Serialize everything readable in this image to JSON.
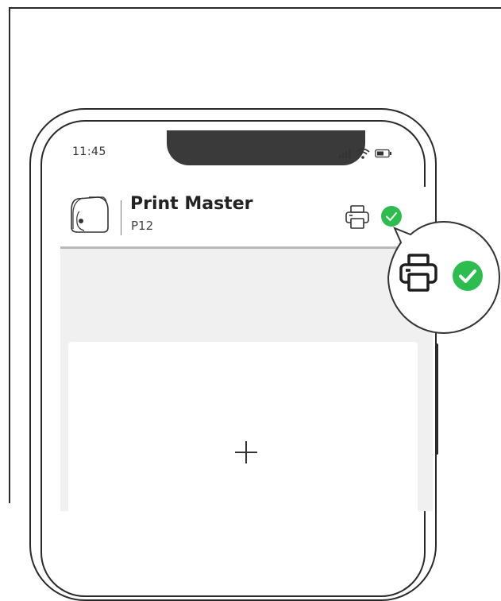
{
  "status_bar": {
    "time": "11:45"
  },
  "header": {
    "app_title": "Print Master",
    "device_model": "P12",
    "printer_icon": "printer-icon",
    "status_icon": "check-circle-icon",
    "status_color": "#2dbd4e"
  },
  "content": {
    "add_icon": "plus-icon"
  },
  "callout": {
    "printer_icon": "printer-icon",
    "status_icon": "check-circle-icon"
  },
  "colors": {
    "accent_green": "#2dbd4e",
    "content_bg": "#f0f0f0",
    "outline": "#2a2a2a"
  }
}
